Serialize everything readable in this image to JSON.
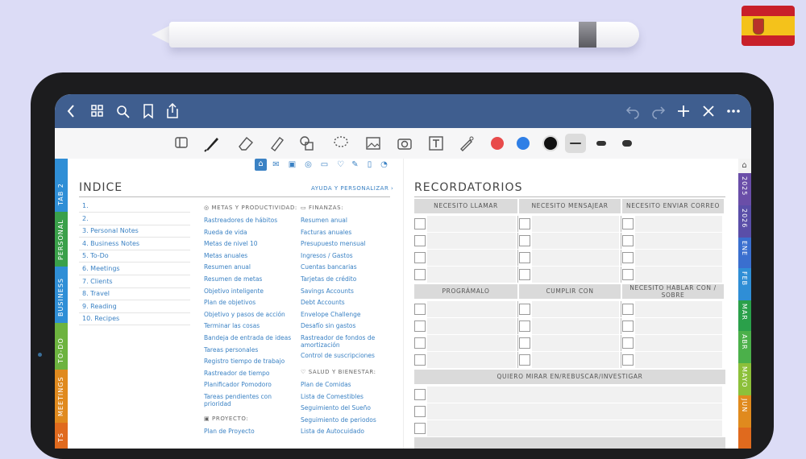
{
  "toolbar": {
    "back_icon": "chevron-left-icon",
    "grid_icon": "grid-icon",
    "search_icon": "search-icon",
    "bookmark_icon": "bookmark-icon",
    "share_icon": "share-icon",
    "undo_icon": "undo-icon",
    "redo_icon": "redo-icon",
    "add_icon": "plus-icon",
    "close_icon": "close-icon",
    "more_icon": "more-icon"
  },
  "colors": {
    "topbar": "#3f5e8f",
    "link_blue": "#3b82c4",
    "pen_red": "#e84b4b",
    "pen_blue": "#2f7fe6",
    "pen_black": "#111111"
  },
  "left_tabs": [
    {
      "label": "TAB 2",
      "color": "#2f8ed6"
    },
    {
      "label": "PERSONAL",
      "color": "#3aa04a"
    },
    {
      "label": "BUSINESS",
      "color": "#2f8ed6"
    },
    {
      "label": "TO-DO",
      "color": "#6db33f"
    },
    {
      "label": "MEETINGS",
      "color": "#e08a1e"
    },
    {
      "label": "TS",
      "color": "#e06a1e"
    }
  ],
  "right_tabs": [
    {
      "label": "2025",
      "color": "#6a4ea8"
    },
    {
      "label": "2026",
      "color": "#5a4ea8"
    },
    {
      "label": "ENE",
      "color": "#3a6fcf"
    },
    {
      "label": "FEB",
      "color": "#2f8ed6"
    },
    {
      "label": "MAR",
      "color": "#2aa04a"
    },
    {
      "label": "ABR",
      "color": "#4bb04a"
    },
    {
      "label": "MAYO",
      "color": "#8cc03a"
    },
    {
      "label": "JUN",
      "color": "#e08a1e"
    }
  ],
  "index": {
    "title": "INDICE",
    "help": "AYUDA Y PERSONALIZAR",
    "items": [
      "1.",
      "2.",
      "3. Personal Notes",
      "4. Business Notes",
      "5. To-Do",
      "6. Meetings",
      "7. Clients",
      "8. Travel",
      "9. Reading",
      "10. Recipes"
    ]
  },
  "sections": {
    "metas": {
      "title": "METAS Y PRODUCTIVIDAD:",
      "links": [
        "Rastreadores de hábitos",
        "Rueda de vida",
        "Metas de nivel 10",
        "Metas anuales",
        "Resumen anual",
        "Resumen de metas",
        "Objetivo inteligente",
        "Plan de objetivos",
        "Objetivo y pasos de acción",
        "Terminar las cosas",
        "Bandeja de entrada de ideas",
        "Tareas personales",
        "Registro tiempo de trabajo",
        "Rastreador de tiempo",
        "Planificador Pomodoro",
        "Tareas pendientes con prioridad"
      ]
    },
    "proyecto": {
      "title": "PROYECTO:",
      "links": [
        "Plan de Proyecto"
      ]
    },
    "finanzas": {
      "title": "FINANZAS:",
      "links": [
        "Resumen anual",
        "Facturas anuales",
        "Presupuesto mensual",
        "Ingresos / Gastos",
        "Cuentas bancarias",
        "Tarjetas de crédito",
        "Savings Accounts",
        "Debt Accounts",
        "Envelope Challenge",
        "Desafío sin gastos",
        "Rastreador de fondos de amortización",
        "Control de suscripciones"
      ]
    },
    "salud": {
      "title": "SALUD Y BIENESTAR:",
      "links": [
        "Plan de Comidas",
        "Lista de Comestibles",
        "Seguimiento del Sueño",
        "Seguimiento de periodos",
        "Lista de Autocuidado"
      ]
    }
  },
  "reminders": {
    "title": "RECORDATORIOS",
    "group1": [
      "NECESITO LLAMAR",
      "NECESITO MENSAJEAR",
      "NECESITO ENVIAR CORREO"
    ],
    "group2": [
      "PROGRÁMALO",
      "CUMPLIR CON",
      "NECESITO HABLAR CON / SOBRE"
    ],
    "group3": [
      "QUIERO MIRAR EN/REBUSCAR/INVESTIGAR"
    ]
  }
}
